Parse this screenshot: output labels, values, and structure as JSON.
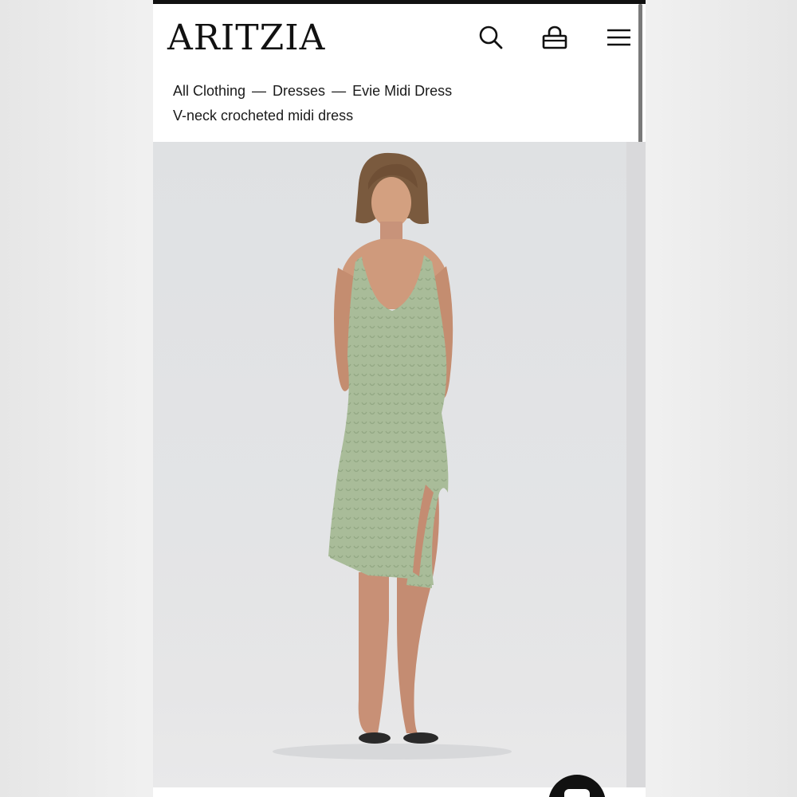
{
  "header": {
    "logo": "ARITZIA",
    "icons": {
      "search": "search-icon",
      "bag": "shopping-bag-icon",
      "menu": "hamburger-menu-icon"
    }
  },
  "breadcrumb": {
    "items": [
      "All Clothing",
      "Dresses",
      "Evie Midi Dress"
    ],
    "separator": "—"
  },
  "product": {
    "subtitle": "V-neck crocheted midi dress",
    "dress_color": "#a8bb98"
  },
  "chat": {
    "icon": "chat-bubble-icon"
  },
  "colors": {
    "accent": "#111111",
    "background": "#ffffff",
    "image_bg": "#e2e3e5"
  }
}
